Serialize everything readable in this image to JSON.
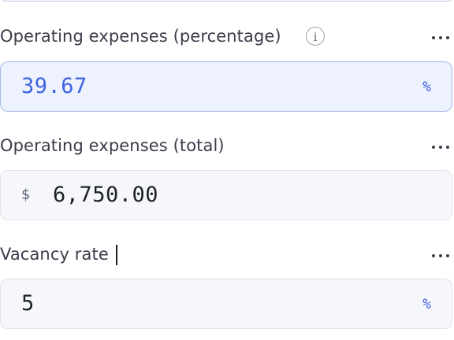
{
  "fields": [
    {
      "label": "Operating expenses (percentage)",
      "value": "39.67",
      "suffix": "%",
      "has_info": true,
      "focused": true
    },
    {
      "label": "Operating expenses (total)",
      "prefix": "$",
      "value": "6,750.00"
    },
    {
      "label": "Vacancy rate",
      "value": "5",
      "suffix": "%"
    }
  ],
  "colors": {
    "accent": "#3f64e3",
    "focused_border": "#a9b8ee",
    "field_bg": "#f6f7fb",
    "label": "#3a3d4a"
  },
  "icons": {
    "info": "info-icon",
    "more": "more-horizontal-icon"
  },
  "glyphs": {
    "info": "i"
  }
}
